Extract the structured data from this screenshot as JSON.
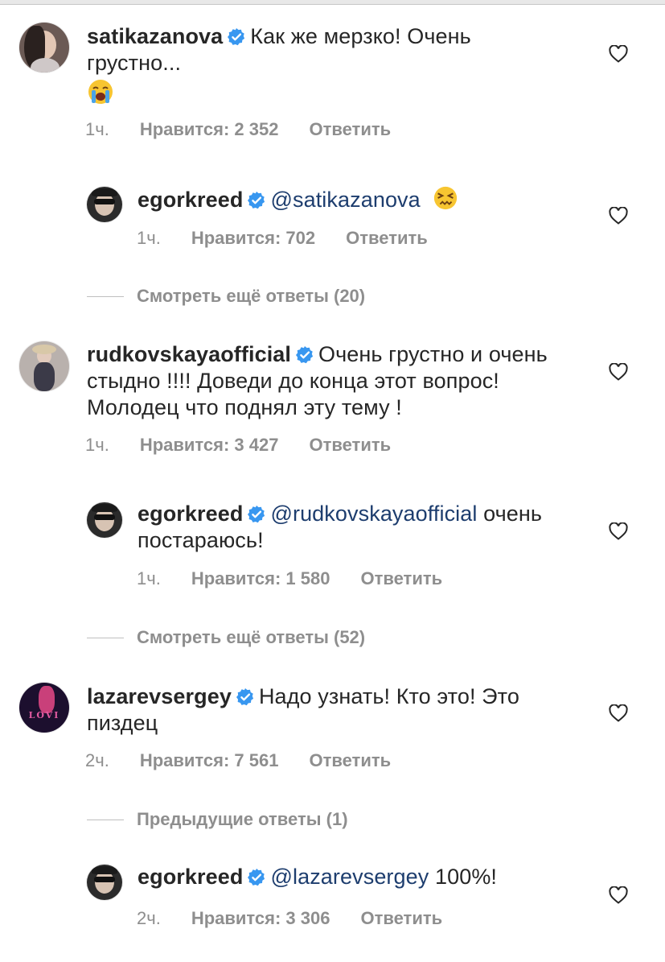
{
  "comments": [
    {
      "user": "satikazanova",
      "text_line1": "Как же мерзко! Очень",
      "text_line2": "грустно...",
      "emoji": "loudly-crying-face",
      "time": "1ч.",
      "likes": "Нравится: 2 352",
      "reply": "Ответить"
    },
    {
      "user": "egorkreed",
      "mention": "@satikazanova",
      "emoji": "persevering-face",
      "time": "1ч.",
      "likes": "Нравится: 702",
      "reply": "Ответить"
    },
    {
      "more": "Смотреть ещё ответы (20)"
    },
    {
      "user": "rudkovskayaofficial",
      "text_line1": "Очень грустно и очень",
      "text_line2": "стыдно !!!! Доведи до конца этот вопрос!",
      "text_line3": "Молодец что поднял эту тему !",
      "time": "1ч.",
      "likes": "Нравится: 3 427",
      "reply": "Ответить"
    },
    {
      "user": "egorkreed",
      "mention": "@rudkovskayaofficial",
      "text_after": "очень",
      "text_line2": "постараюсь!",
      "time": "1ч.",
      "likes": "Нравится: 1 580",
      "reply": "Ответить"
    },
    {
      "more": "Смотреть ещё ответы (52)"
    },
    {
      "user": "lazarevsergey",
      "text_line1": "Надо узнать! Кто это! Это",
      "text_line2": "пиздец",
      "avatar_text": "LOVI",
      "time": "2ч.",
      "likes": "Нравится: 7 561",
      "reply": "Ответить"
    },
    {
      "more": "Предыдущие ответы (1)"
    },
    {
      "user": "egorkreed",
      "mention": "@lazarevsergey",
      "text_after": "100%!",
      "time": "2ч.",
      "likes": "Нравится: 3 306",
      "reply": "Ответить"
    }
  ],
  "icons": {
    "verified": "verified-badge-icon",
    "like": "heart-outline-icon"
  },
  "colors": {
    "verified_blue": "#3897f0",
    "mention": "#1d3d6e",
    "meta_gray": "#8e8e8e"
  }
}
